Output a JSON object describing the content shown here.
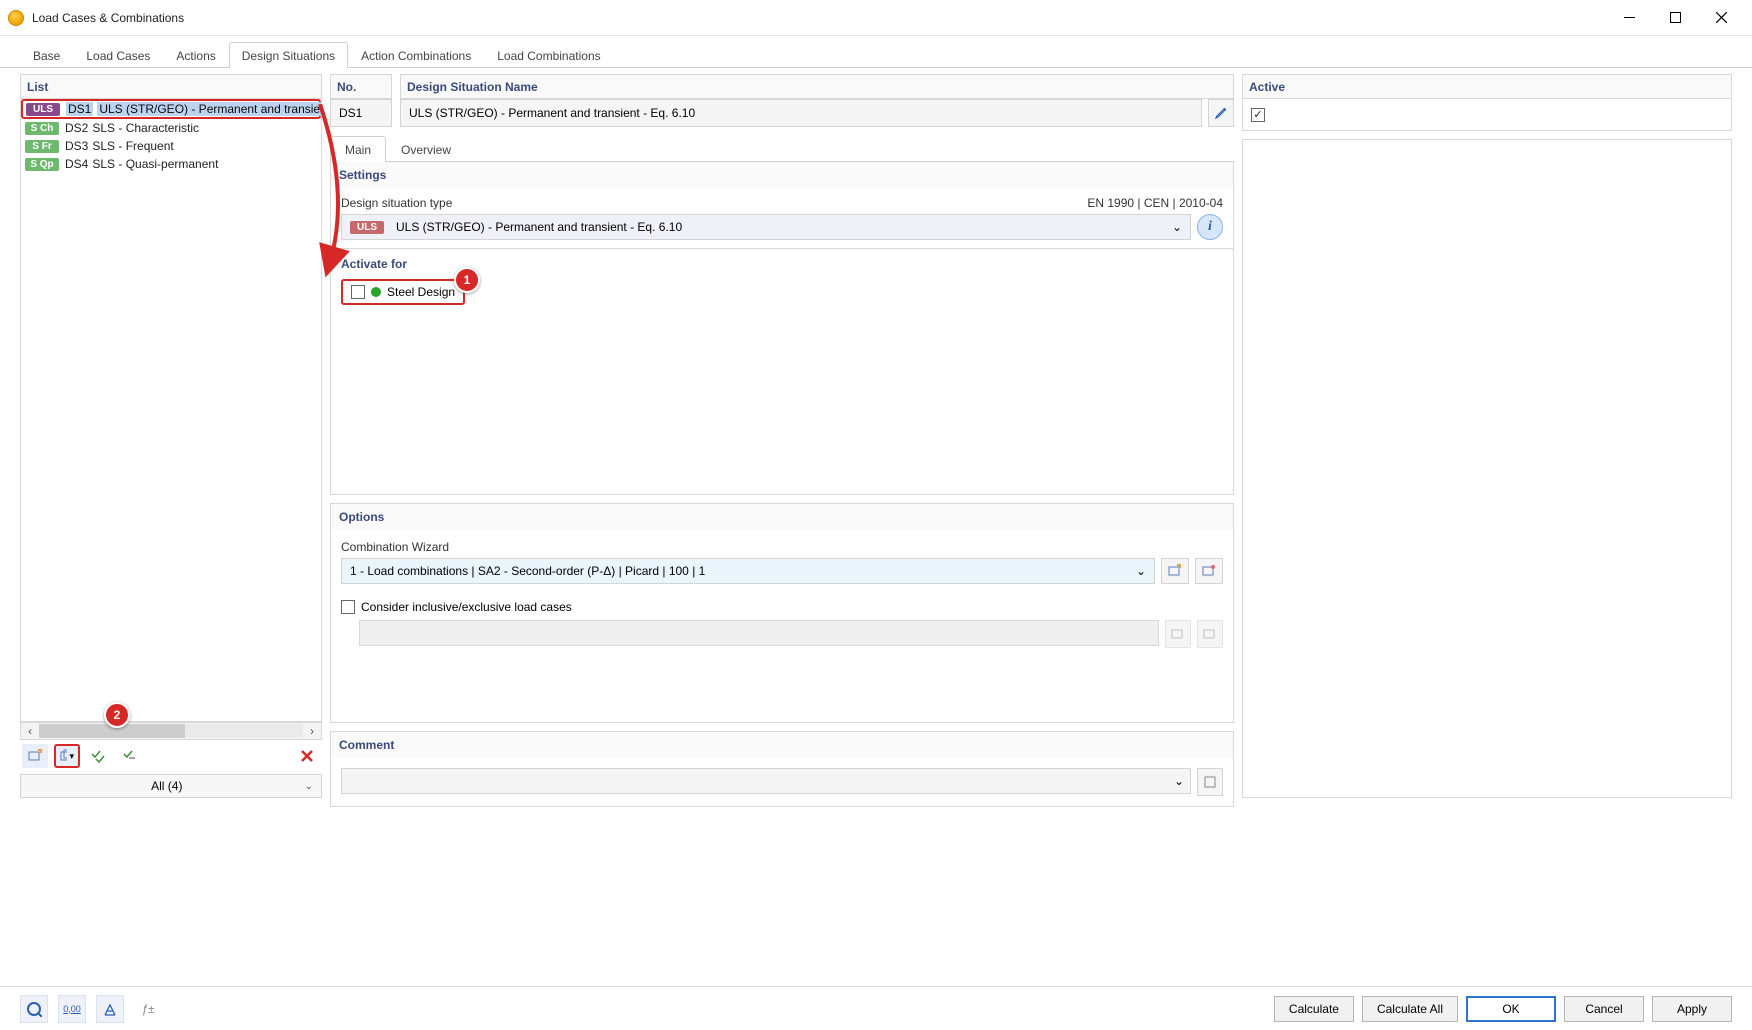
{
  "window": {
    "title": "Load Cases & Combinations"
  },
  "tabs": [
    "Base",
    "Load Cases",
    "Actions",
    "Design Situations",
    "Action Combinations",
    "Load Combinations"
  ],
  "activeTab": "Design Situations",
  "list": {
    "header": "List",
    "items": [
      {
        "tag": "ULS",
        "tagClass": "uls sel",
        "code": "DS1",
        "name": "ULS (STR/GEO) - Permanent and transient - Eq."
      },
      {
        "tag": "S Ch",
        "tagClass": "sch",
        "code": "DS2",
        "name": "SLS - Characteristic"
      },
      {
        "tag": "S Fr",
        "tagClass": "sfr",
        "code": "DS3",
        "name": "SLS - Frequent"
      },
      {
        "tag": "S Qp",
        "tagClass": "sqp",
        "code": "DS4",
        "name": "SLS - Quasi-permanent"
      }
    ],
    "filter": "All (4)"
  },
  "no": {
    "header": "No.",
    "value": "DS1"
  },
  "dsname": {
    "header": "Design Situation Name",
    "value": "ULS (STR/GEO) - Permanent and transient - Eq. 6.10"
  },
  "active": {
    "header": "Active"
  },
  "subtabs": [
    "Main",
    "Overview"
  ],
  "activeSubtab": "Main",
  "settings": {
    "header": "Settings",
    "typeLabel": "Design situation type",
    "standard": "EN 1990 | CEN | 2010-04",
    "typeValue": "ULS (STR/GEO) - Permanent and transient - Eq. 6.10",
    "typeTag": "ULS"
  },
  "activate": {
    "header": "Activate for",
    "steel": "Steel Design"
  },
  "options": {
    "header": "Options",
    "cwLabel": "Combination Wizard",
    "cwValue": "1 - Load combinations | SA2 - Second-order (P-Δ) | Picard | 100 | 1",
    "consider": "Consider inclusive/exclusive load cases"
  },
  "comment": {
    "header": "Comment"
  },
  "footer": {
    "calculate": "Calculate",
    "calculateAll": "Calculate All",
    "ok": "OK",
    "cancel": "Cancel",
    "apply": "Apply"
  },
  "callouts": {
    "one": "1",
    "two": "2"
  }
}
